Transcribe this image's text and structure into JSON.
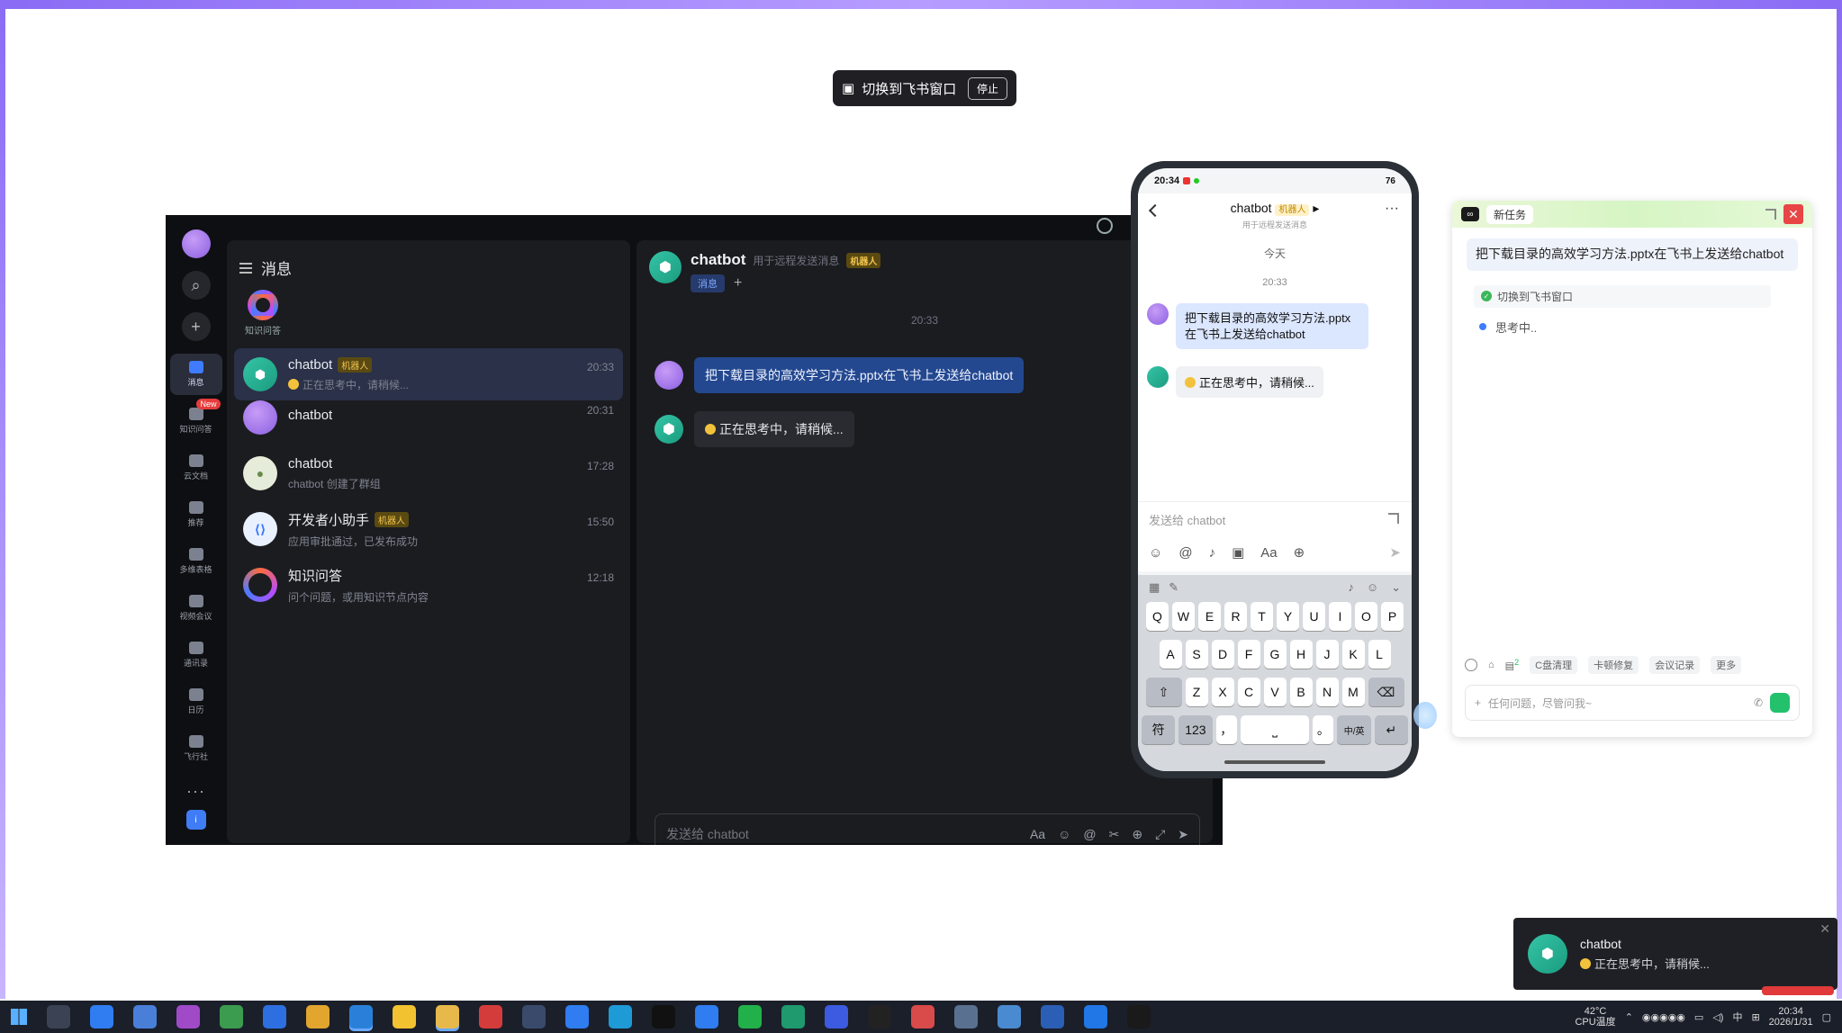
{
  "share_bar": {
    "label": "切换到飞书窗口",
    "stop": "停止"
  },
  "desktop": {
    "rail": {
      "items": [
        {
          "label": "消息",
          "active": true
        },
        {
          "label": "知识问答",
          "badge": "New"
        },
        {
          "label": "云文档"
        },
        {
          "label": "推荐"
        },
        {
          "label": "多维表格"
        },
        {
          "label": "视频会议"
        },
        {
          "label": "通讯录"
        },
        {
          "label": "日历"
        },
        {
          "label": "飞行社"
        }
      ]
    },
    "conversations": {
      "title": "消息",
      "pinned_label": "知识问答",
      "items": [
        {
          "name": "chatbot",
          "tag": "机器人",
          "preview": "正在思考中，请稍候...",
          "time": "20:33",
          "avatar": "bot"
        },
        {
          "name": "chatbot",
          "tag": "",
          "preview": "",
          "time": "20:31",
          "avatar": "purple"
        },
        {
          "name": "chatbot",
          "tag": "",
          "preview": "chatbot 创建了群组",
          "time": "17:28",
          "avatar": "grp"
        },
        {
          "name": "开发者小助手",
          "tag": "机器人",
          "preview": "应用审批通过，已发布成功",
          "time": "15:50",
          "avatar": "dev"
        },
        {
          "name": "知识问答",
          "tag": "",
          "preview": "问个问题，或用知识节点内容",
          "time": "12:18",
          "avatar": "ringav"
        }
      ]
    },
    "chat": {
      "title": "chatbot",
      "subtitle": "用于远程发送消息",
      "tag": "机器人",
      "tab": "消息",
      "time": "20:33",
      "user_msg": "把下载目录的高效学习方法.pptx在飞书上发送给chatbot",
      "bot_msg": "正在思考中，请稍候...",
      "input_placeholder": "发送给 chatbot"
    }
  },
  "phone": {
    "status_time": "20:34",
    "battery": "76",
    "title": "chatbot",
    "tag": "机器人",
    "subtitle": "用于远程发送消息",
    "day": "今天",
    "time": "20:33",
    "user_msg": "把下载目录的高效学习方法.pptx在飞书上发送给chatbot",
    "bot_msg": "正在思考中，请稍候...",
    "input_placeholder": "发送给 chatbot",
    "keyboard": {
      "row1": [
        "Q",
        "W",
        "E",
        "R",
        "T",
        "Y",
        "U",
        "I",
        "O",
        "P"
      ],
      "row2": [
        "A",
        "S",
        "D",
        "F",
        "G",
        "H",
        "J",
        "K",
        "L"
      ],
      "row3": [
        "Z",
        "X",
        "C",
        "V",
        "B",
        "N",
        "M"
      ],
      "row4_left": "符",
      "row4_num": "123",
      "row4_comma": "，",
      "row4_period": "。",
      "row4_lang": "中/英"
    }
  },
  "assistant": {
    "new_task": "新任务",
    "question": "把下载目录的高效学习方法.pptx在飞书上发送给chatbot",
    "step": "切换到飞书窗口",
    "thinking": "思考中..",
    "badge": "2",
    "chips": [
      "C盘清理",
      "卡顿修复",
      "会议记录",
      "更多"
    ],
    "input_placeholder": "任何问题，尽管问我~"
  },
  "notification": {
    "title": "chatbot",
    "body": "正在思考中，请稍候..."
  },
  "taskbar": {
    "temp": "42°C",
    "temp_label": "CPU温度",
    "ime": "中",
    "time": "20:34",
    "date": "2026/1/31"
  },
  "colors": {
    "accent_blue": "#3e7bff",
    "user_bubble": "#23488f",
    "bot_green": "#1b9c80",
    "robot_tag": "#f3c44e"
  }
}
